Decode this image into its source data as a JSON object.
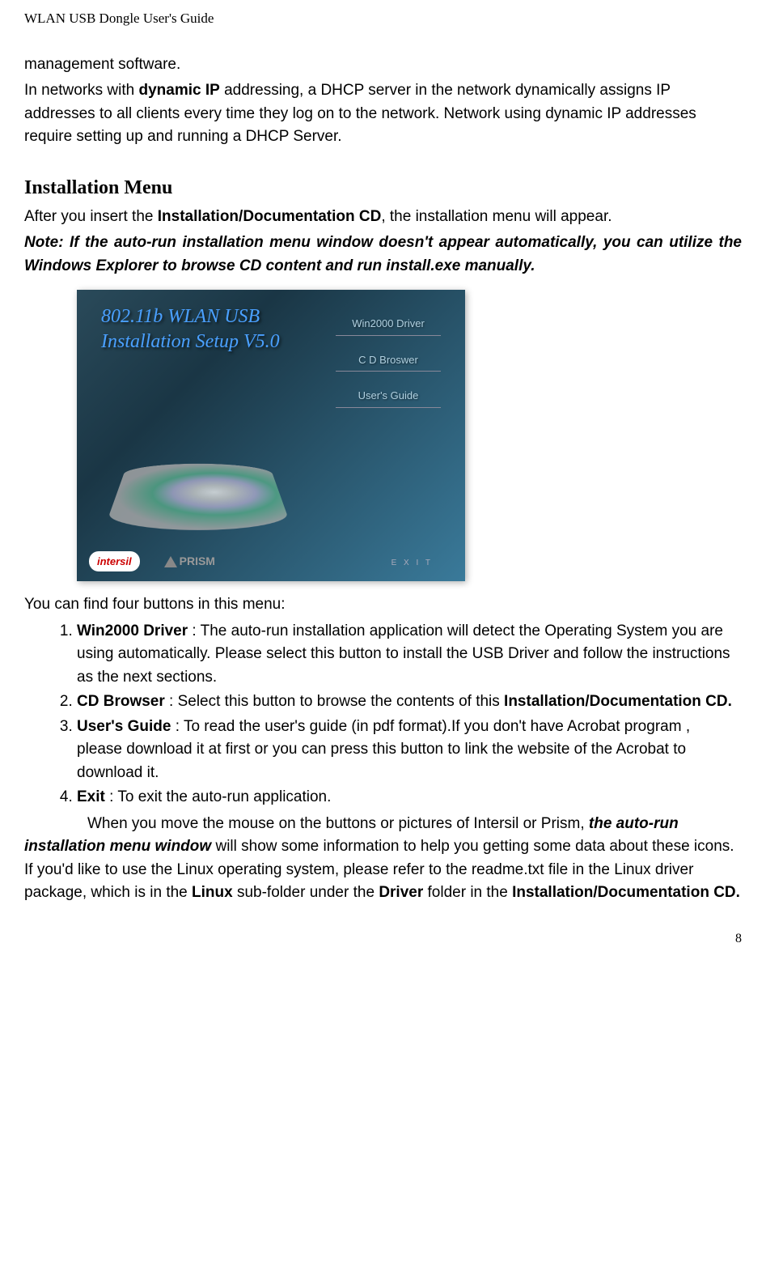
{
  "header": "WLAN USB Dongle User's Guide",
  "intro": {
    "line1": "management software.",
    "line2a": "In networks with ",
    "line2b": "dynamic IP",
    "line2c": " addressing, a DHCP server in the network dynamically assigns IP addresses to all clients every time they log on to the network. Network using dynamic IP addresses require setting up and running a DHCP Server."
  },
  "section_title": "Installation Menu",
  "after_title_a": "After you insert the ",
  "after_title_b": "Installation/Documentation CD",
  "after_title_c": ", the installation menu will appear.",
  "note": "Note: If the auto-run installation menu window doesn't appear automatically, you can utilize the Windows Explorer to browse CD content and run install.exe manually.",
  "screenshot": {
    "title_line1": "802.11b WLAN  USB",
    "title_line2": "Installation Setup V5.0",
    "link1": "Win2000 Driver",
    "link2": "C D  Broswer",
    "link3": "User's Guide",
    "logo1": "intersil",
    "logo2": "PRISM",
    "exit": "E X I T"
  },
  "post_img": "You can find four buttons in this menu:",
  "items": [
    {
      "label": "Win2000 Driver",
      "text": " : The auto-run installation application will detect the Operating System you are using automatically. Please select this button to install the USB Driver and follow the instructions as the next sections."
    },
    {
      "label": "CD Browser",
      "text": " : Select this button to browse the contents of this ",
      "trail": "Installation/Documentation CD."
    },
    {
      "label": "User's Guide",
      "text": " : To read the user's guide (in pdf format).If you don't have Acrobat program , please download it at first or you can press this button to link the website of the Acrobat to download it."
    },
    {
      "label": "Exit",
      "text": " : To exit the auto-run application."
    }
  ],
  "tail": {
    "p1a": "When you move the mouse on the buttons or pictures of Intersil or Prism, ",
    "p1b": "the auto-run installation menu window",
    "p1c": " will show some information to help you getting some data about these icons. If you'd like to use the Linux operating system, please refer to the readme.txt file in the Linux driver package, which is in the ",
    "p1d": "Linux",
    "p1e": " sub-folder under the ",
    "p1f": "Driver",
    "p1g": " folder in the ",
    "p1h": "Installation/Documentation CD."
  },
  "page_num": "8"
}
